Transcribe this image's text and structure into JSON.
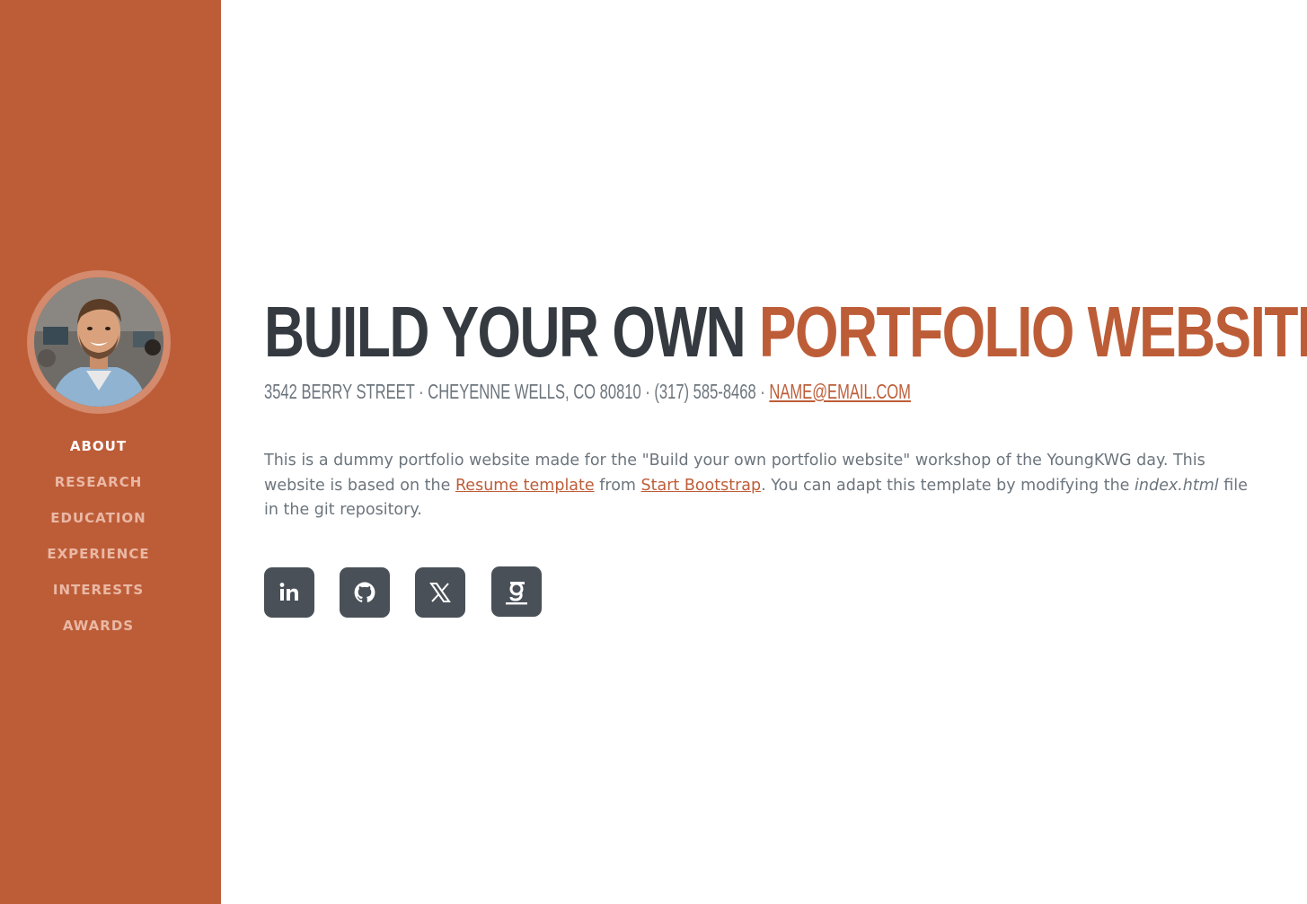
{
  "nav": {
    "items": [
      {
        "label": "ABOUT",
        "active": true
      },
      {
        "label": "RESEARCH",
        "active": false
      },
      {
        "label": "EDUCATION",
        "active": false
      },
      {
        "label": "EXPERIENCE",
        "active": false
      },
      {
        "label": "INTERESTS",
        "active": false
      },
      {
        "label": "AWARDS",
        "active": false
      }
    ]
  },
  "header": {
    "title_part1": "BUILD YOUR OWN",
    "title_part2": "PORTFOLIO WEBSITE",
    "address": "3542 BERRY STREET · CHEYENNE WELLS, CO 80810 · (317) 585-8468 · ",
    "email": "NAME@EMAIL.COM"
  },
  "lead": {
    "text1": "This is a dummy portfolio website made for the \"Build your own portfolio website\" workshop of the YoungKWG day. This website is based on the ",
    "link1": "Resume template",
    "text2": " from ",
    "link2": "Start Bootstrap",
    "text3": ". You can adapt this template by modifying the ",
    "italic": "index.html",
    "text4": " file in the git repository."
  },
  "social": [
    {
      "icon": "linkedin-icon"
    },
    {
      "icon": "github-icon"
    },
    {
      "icon": "x-twitter-icon"
    },
    {
      "icon": "google-scholar-icon"
    }
  ],
  "colors": {
    "primary": "#bd5d38",
    "dark": "#343a40",
    "muted": "#6c757d",
    "social_bg": "#495057"
  }
}
